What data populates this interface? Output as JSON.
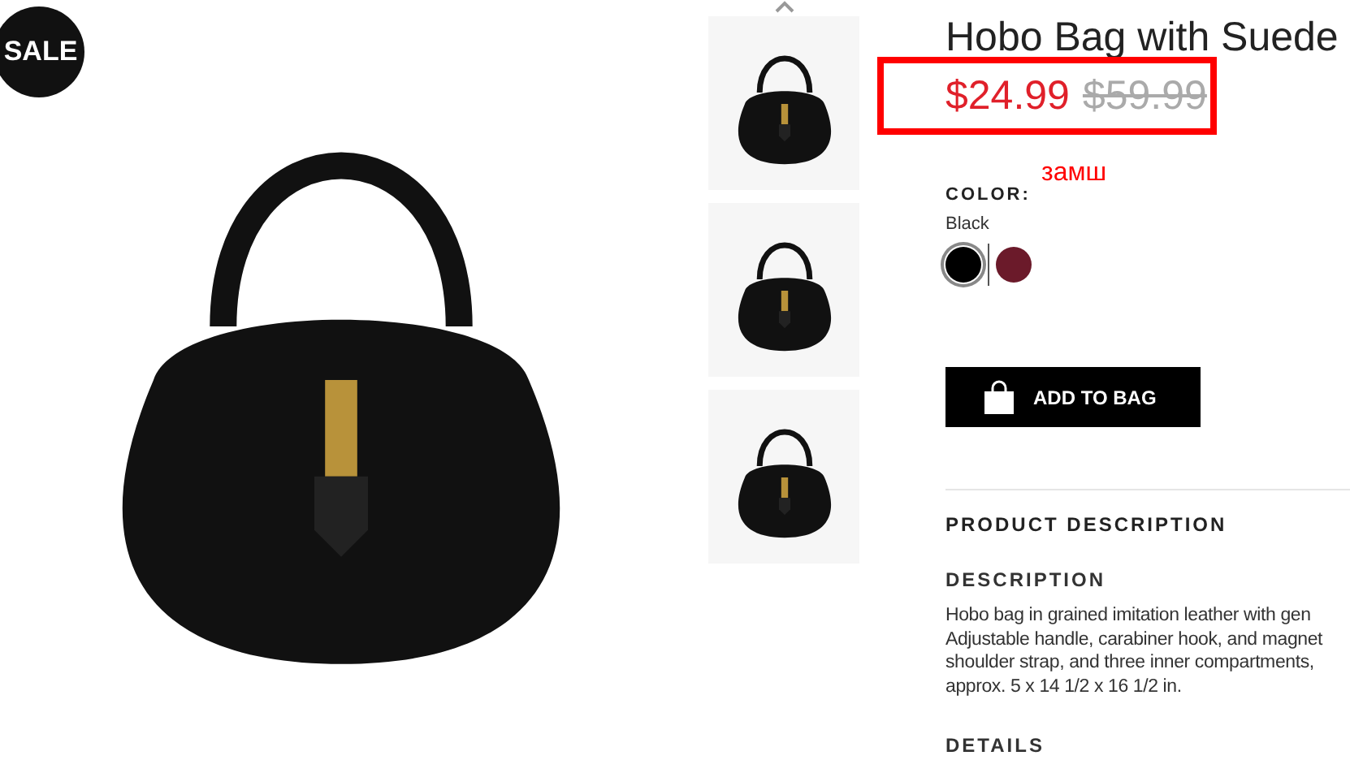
{
  "badge": "SALE",
  "thumbnails": [
    {
      "selected": false
    },
    {
      "selected": false
    },
    {
      "selected": false
    }
  ],
  "product": {
    "title": "Hobo Bag with Suede",
    "price": "$24.99",
    "old_price": "$59.99",
    "color_label": "COLOR:",
    "color_name": "Black",
    "swatches": [
      {
        "color": "#000000",
        "selected": true
      },
      {
        "color": "#6b1a2a",
        "selected": false
      }
    ],
    "add_to_bag": "ADD TO BAG",
    "section_title": "PRODUCT DESCRIPTION",
    "description_title": "DESCRIPTION",
    "description_lines": [
      "Hobo bag in grained imitation leather with gen",
      "Adjustable handle, carabiner hook, and magnet",
      "shoulder strap, and three inner compartments,",
      "approx. 5 x 14 1/2 x 16 1/2 in."
    ],
    "details_title": "DETAILS"
  },
  "annotation": {
    "note": "замш"
  }
}
